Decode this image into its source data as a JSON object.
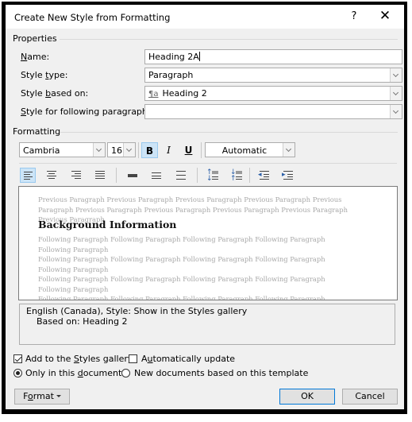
{
  "dialog": {
    "title": "Create New Style from Formatting",
    "help_label": "?",
    "close_icon": "close-icon"
  },
  "properties": {
    "section_label": "Properties",
    "name": {
      "label": "Name:",
      "value": "Heading 2A"
    },
    "style_type": {
      "label": "Style type:",
      "value": "Paragraph"
    },
    "style_based_on": {
      "label": "Style based on:",
      "value": "Heading 2",
      "icon": "paragraph-style-icon"
    },
    "following_paragraph": {
      "label": "Style for following paragraph:",
      "value": ""
    }
  },
  "formatting": {
    "section_label": "Formatting",
    "font": "Cambria",
    "size": "16",
    "bold": "B",
    "italic": "I",
    "underline": "U",
    "bold_active": true,
    "color": "Automatic",
    "align_buttons": [
      {
        "name": "align-left",
        "active": true
      },
      {
        "name": "align-center",
        "active": false
      },
      {
        "name": "align-right",
        "active": false
      },
      {
        "name": "justify",
        "active": false
      },
      {
        "name": "single-spacing",
        "active": false
      },
      {
        "name": "one-half-spacing",
        "active": false
      },
      {
        "name": "double-spacing",
        "active": false
      },
      {
        "name": "increase-paragraph-spacing",
        "active": false
      },
      {
        "name": "decrease-paragraph-spacing",
        "active": false
      },
      {
        "name": "decrease-indent",
        "active": false
      },
      {
        "name": "increase-indent",
        "active": false
      }
    ]
  },
  "preview": {
    "previous_text": "Previous Paragraph Previous Paragraph Previous Paragraph Previous Paragraph Previous Paragraph Previous Paragraph Previous Paragraph Previous Paragraph Previous Paragraph Previous Paragraph",
    "heading": "Background Information",
    "following_lines": [
      "Following Paragraph Following Paragraph Following Paragraph Following Paragraph Following Paragraph",
      "Following Paragraph Following Paragraph Following Paragraph Following Paragraph Following Paragraph",
      "Following Paragraph Following Paragraph Following Paragraph Following Paragraph Following Paragraph",
      "Following Paragraph Following Paragraph Following Paragraph Following Paragraph Following Paragraph",
      "Following Paragraph Following Paragraph Following Paragraph Following Paragraph Following Paragraph",
      "Following Paragraph Following Paragraph Following Paragraph Following Paragraph Following Paragraph",
      "Following Paragraph Following Paragraph Following Paragraph Following Paragraph Following Paragraph"
    ]
  },
  "description": {
    "line1": "English (Canada), Style: Show in the Styles gallery",
    "line2": "Based on: Heading 2"
  },
  "options": {
    "add_to_gallery": {
      "label": "Add to the Styles gallery",
      "checked": true
    },
    "auto_update": {
      "label": "Automatically update",
      "checked": false
    },
    "only_this_doc": {
      "label": "Only in this document",
      "selected": true
    },
    "new_docs_template": {
      "label": "New documents based on this template",
      "selected": false
    }
  },
  "buttons": {
    "format": "Format",
    "ok": "OK",
    "cancel": "Cancel"
  },
  "colors": {
    "accent": "#0078d7",
    "active_bg": "#cce4f7"
  }
}
